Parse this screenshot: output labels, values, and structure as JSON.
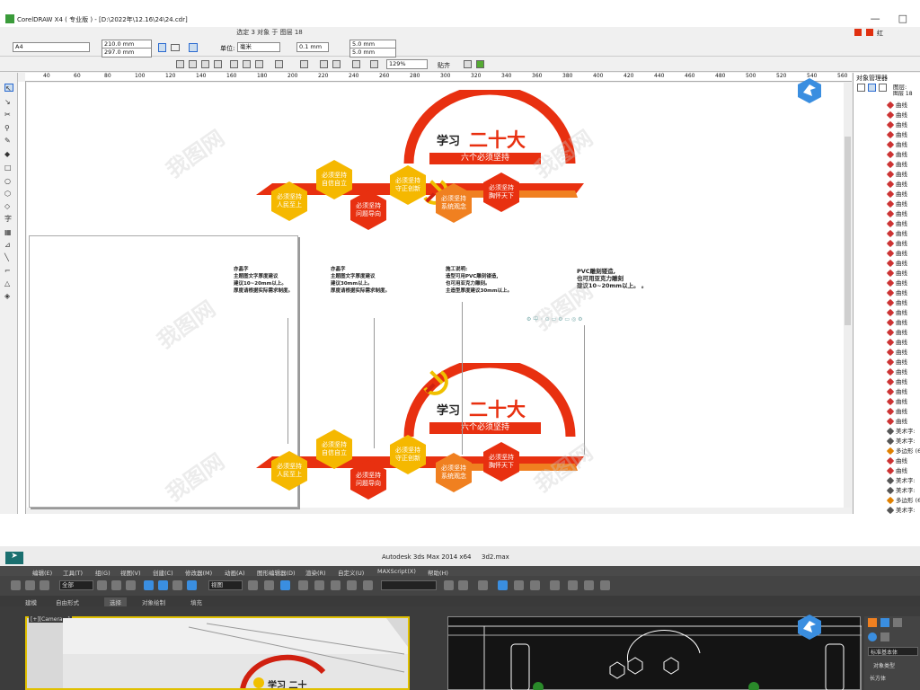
{
  "coreldraw": {
    "title": "CorelDRAW X4 ( 专业版 ) - [D:\\2022年\\12.16\\24\\24.cdr]",
    "selection_status": "选定 3 对象 于 图层 18",
    "color_name": "红",
    "color_hex": "#e03010",
    "paper_size": "A4",
    "width": "210.0 mm",
    "height": "297.0 mm",
    "unit_label": "单位:",
    "unit_value": "毫米",
    "nudge": "0.1 mm",
    "dup_x": "5.0 mm",
    "dup_y": "5.0 mm",
    "zoom": "129%",
    "snap": "贴齐",
    "ruler_ticks": [
      "40",
      "60",
      "80",
      "100",
      "120",
      "140",
      "160",
      "180",
      "200",
      "220",
      "240",
      "260",
      "280",
      "300",
      "320",
      "340",
      "360",
      "380",
      "400",
      "420",
      "440",
      "460",
      "480",
      "500",
      "520",
      "540",
      "560"
    ],
    "object_manager": {
      "title": "对象管理器",
      "layer_label": "图层:",
      "layer_name": "图层 18",
      "items": [
        "曲线",
        "曲线",
        "曲线",
        "曲线",
        "曲线",
        "曲线",
        "曲线",
        "曲线",
        "曲线",
        "曲线",
        "曲线",
        "曲线",
        "曲线",
        "曲线",
        "曲线",
        "曲线",
        "曲线",
        "曲线",
        "曲线",
        "曲线",
        "曲线",
        "曲线",
        "曲线",
        "曲线",
        "曲线",
        "曲线",
        "曲线",
        "曲线",
        "曲线",
        "曲线",
        "曲线",
        "曲线",
        "曲线",
        "美术字:",
        "美术字:",
        "多边形 (6",
        "曲线",
        "曲线",
        "美术字:",
        "美术字:",
        "多边形 (6",
        "美术字:",
        "多边形 (6"
      ]
    },
    "design": {
      "heading": "学习二十大",
      "heading_small": "学习",
      "heading_big": "二十大",
      "subtitle": "六个必须坚持",
      "hexes": [
        "必须坚持\n人民至上",
        "必须坚持\n自信自立",
        "必须坚持\n问题导向",
        "必须坚持\n守正创新",
        "必须坚持\n系统观念",
        "必须坚持\n胸怀天下"
      ]
    },
    "notes": [
      {
        "title": "亦晶字",
        "lines": [
          "主题图文字厚度建议",
          "建议10~20mm以上。",
          "厚度请根据实际需求制度。"
        ]
      },
      {
        "title": "亦晶字",
        "lines": [
          "主题图文字厚度建议",
          "建议30mm以上。",
          "厚度请根据实际需求制度。"
        ]
      },
      {
        "title": "施工说明:",
        "lines": [
          "造型可用PVC雕刻镂造,",
          "也可用亚克力雕刻。",
          "主造型厚度建议30mm以上。"
        ]
      },
      {
        "title": "PVC雕刻镂造,",
        "lines": [
          "也可用亚克力雕刻",
          "建议10~20mm以上。  。"
        ]
      }
    ],
    "watermark": "我图网"
  },
  "max": {
    "title": "Autodesk 3ds Max  2014 x64",
    "file": "3d2.max",
    "menu": [
      "编辑(E)",
      "工具(T)",
      "组(G)",
      "视图(V)",
      "创建(C)",
      "修改器(M)",
      "动画(A)",
      "图形编辑器(D)",
      "渲染(R)",
      "自定义(U)",
      "MAXScript(X)",
      "帮助(H)"
    ],
    "all_filter": "全部",
    "view_dropdown": "视图",
    "tabs": [
      "建模",
      "自由形式",
      "选择",
      "对象绘制",
      "填充"
    ],
    "viewport_label": "[+][Camera...]",
    "right_panel": [
      "标准基本体",
      "对象类型",
      "长方体"
    ]
  }
}
